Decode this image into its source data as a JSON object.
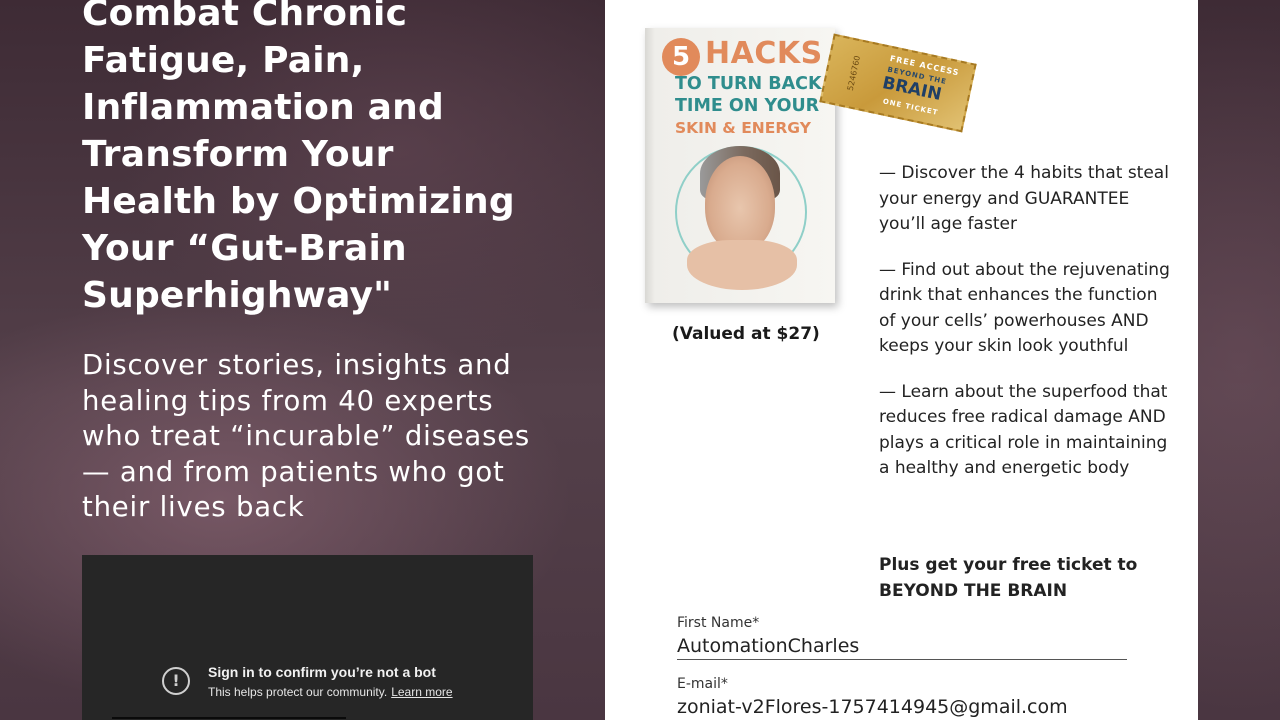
{
  "hero": {
    "headline": "Combat Chronic Fatigue, Pain, Inflammation and Transform Your Health by Optimizing Your “Gut-Brain Superhighway\"",
    "subhead": "Discover stories, insights and healing tips from 40 experts who treat “incurable” diseases — and from patients who got their lives back"
  },
  "video": {
    "bot_title": "Sign in to confirm you’re not a bot",
    "bot_sub": "This helps protect our community.",
    "learn_more": "Learn more",
    "icon": "exclamation-circle-icon"
  },
  "offer": {
    "book": {
      "number": "5",
      "hacks": "HACKS",
      "line1": "TO TURN BACK",
      "line2": "TIME ON YOUR",
      "line3": "SKIN & ENERGY"
    },
    "ticket": {
      "free_access": "FREE ACCESS",
      "beyond_the": "BEYOND THE",
      "brain": "BRAIN",
      "one_ticket": "ONE TICKET",
      "number": "5246760"
    },
    "valued": "(Valued at $27)",
    "bullets": [
      "— Discover the 4 habits that steal your energy and GUARANTEE you’ll age faster",
      "— Find out about the rejuvenating drink that enhances the function of your cells’ powerhouses AND keeps your skin look youthful",
      "— Learn about the superfood that reduces free radical damage AND plays a critical role in maintaining a healthy and energetic body"
    ],
    "plus": "Plus get your free ticket to BEYOND THE BRAIN"
  },
  "form": {
    "first_name_label": "First Name*",
    "first_name_value": "AutomationCharles",
    "email_label": "E-mail*",
    "email_value": "zoniat-v2Flores-1757414945@gmail.com"
  },
  "colors": {
    "accent_orange": "#e18a5b",
    "accent_teal": "#2f8d8d",
    "background": "#4a3540"
  }
}
